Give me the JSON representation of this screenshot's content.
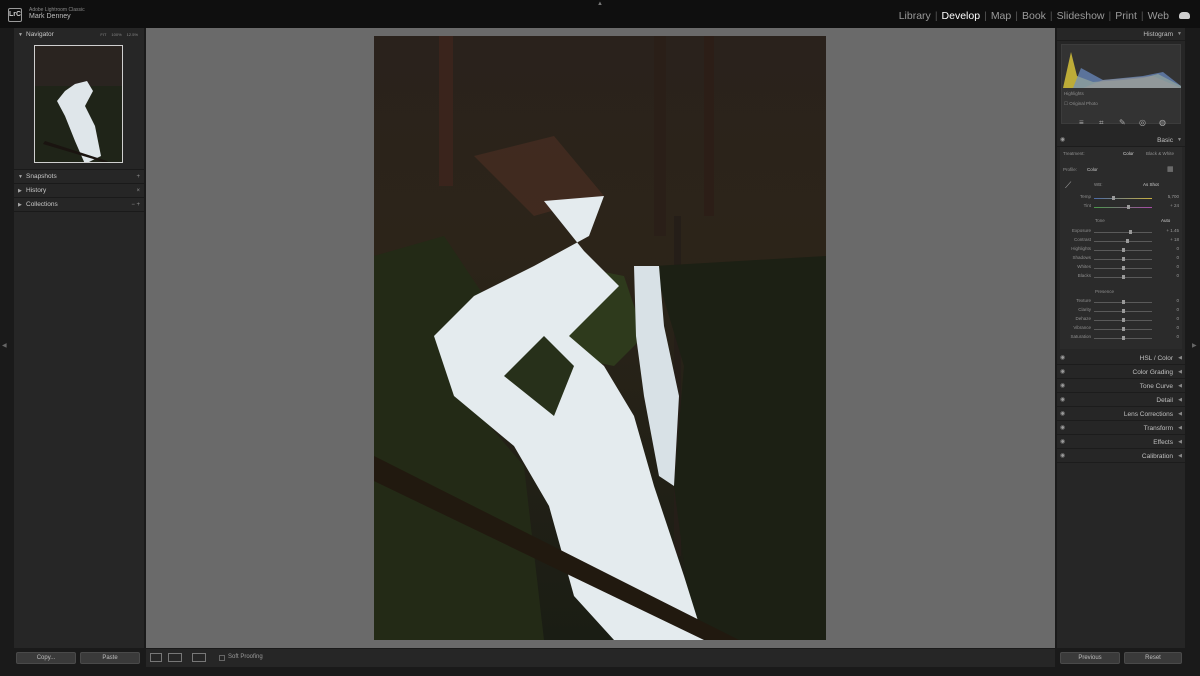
{
  "app": {
    "name": "Adobe Lightroom Classic",
    "user": "Mark Denney",
    "logo": "LrC"
  },
  "modules": [
    {
      "label": "Library",
      "active": false
    },
    {
      "label": "Develop",
      "active": true
    },
    {
      "label": "Map",
      "active": false
    },
    {
      "label": "Book",
      "active": false
    },
    {
      "label": "Slideshow",
      "active": false
    },
    {
      "label": "Print",
      "active": false
    },
    {
      "label": "Web",
      "active": false
    }
  ],
  "module_separator": "|",
  "left_panel": {
    "navigator": {
      "title": "Navigator",
      "zoom": [
        "FIT",
        "100%",
        "12.5%"
      ]
    },
    "snapshots": {
      "title": "Snapshots",
      "action": "+"
    },
    "history": {
      "title": "History",
      "action": "×"
    },
    "collections": {
      "title": "Collections",
      "action": "− +"
    },
    "copy_label": "Copy...",
    "paste_label": "Paste"
  },
  "toolbar": {
    "soft_proofing": "Soft Proofing"
  },
  "right_panel": {
    "histogram_title": "Histogram",
    "histogram_label": "Highlights",
    "original_photo": "Original Photo",
    "basic": {
      "title": "Basic",
      "treatment_label": "Treatment:",
      "treatment_color": "Color",
      "treatment_bw": "Black & White",
      "profile_label": "Profile:",
      "profile_value": "Color",
      "wb_label": "WB:",
      "wb_value": "As Shot",
      "temp_label": "Temp",
      "temp_value": "5,700",
      "tint_label": "Tint",
      "tint_value": "+ 24",
      "tone_label": "Tone",
      "auto_label": "Auto",
      "presence_label": "Presence",
      "tone_sliders": [
        {
          "label": "Exposure",
          "value": "+ 1.45",
          "pos": 0.62
        },
        {
          "label": "Contrast",
          "value": "+ 18",
          "pos": 0.57
        },
        {
          "label": "Highlights",
          "value": "0",
          "pos": 0.5
        },
        {
          "label": "Shadows",
          "value": "0",
          "pos": 0.5
        },
        {
          "label": "Whites",
          "value": "0",
          "pos": 0.5
        },
        {
          "label": "Blacks",
          "value": "0",
          "pos": 0.5
        }
      ],
      "presence_sliders": [
        {
          "label": "Texture",
          "value": "0",
          "pos": 0.5
        },
        {
          "label": "Clarity",
          "value": "0",
          "pos": 0.5
        },
        {
          "label": "Dehaze",
          "value": "0",
          "pos": 0.5
        },
        {
          "label": "Vibrance",
          "value": "0",
          "pos": 0.5
        },
        {
          "label": "Saturation",
          "value": "0",
          "pos": 0.5
        }
      ]
    },
    "sections": [
      "HSL / Color",
      "Color Grading",
      "Tone Curve",
      "Detail",
      "Lens Corrections",
      "Transform",
      "Effects",
      "Calibration"
    ],
    "previous_label": "Previous",
    "reset_label": "Reset"
  },
  "colors": {
    "accent": "#ffffff",
    "panel": "#262626",
    "canvas": "#6a6a6a"
  }
}
